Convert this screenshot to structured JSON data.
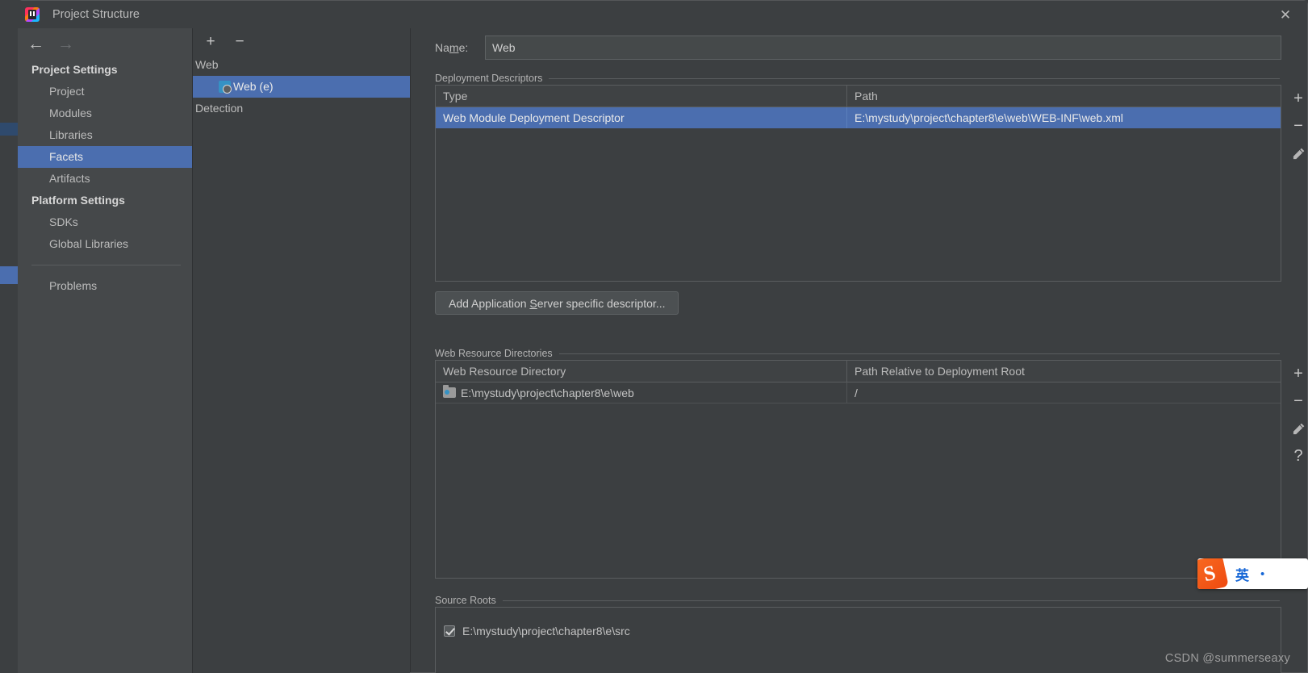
{
  "window": {
    "title": "Project Structure",
    "app_icon": "intellij-idea-icon",
    "close_label": "✕"
  },
  "nav": {
    "back_icon": "←",
    "forward_icon": "→",
    "sections": [
      {
        "group": "Project Settings",
        "items": [
          {
            "label": "Project",
            "selected": false
          },
          {
            "label": "Modules",
            "selected": false
          },
          {
            "label": "Libraries",
            "selected": false
          },
          {
            "label": "Facets",
            "selected": true
          },
          {
            "label": "Artifacts",
            "selected": false
          }
        ]
      },
      {
        "group": "Platform Settings",
        "items": [
          {
            "label": "SDKs",
            "selected": false
          },
          {
            "label": "Global Libraries",
            "selected": false
          }
        ]
      }
    ],
    "problems": "Problems"
  },
  "facets_panel": {
    "add_icon": "+",
    "remove_icon": "−",
    "tree": [
      {
        "label": "Web",
        "child": false,
        "selected": false,
        "icon": null
      },
      {
        "label": "Web (e)",
        "child": true,
        "selected": true,
        "icon": "web-facet-icon"
      },
      {
        "label": "Detection",
        "child": false,
        "selected": false,
        "icon": null
      }
    ]
  },
  "main": {
    "name_label_pre": "Na",
    "name_label_mnemonic": "m",
    "name_label_post": "e:",
    "name_value": "Web",
    "name_placeholder": "",
    "deployment": {
      "section_title": "Deployment Descriptors",
      "columns": [
        "Type",
        "Path"
      ],
      "rows": [
        {
          "type": "Web Module Deployment Descriptor",
          "path": "E:\\mystudy\\project\\chapter8\\e\\web\\WEB-INF\\web.xml",
          "selected": true
        }
      ],
      "tools": [
        "+",
        "−",
        "pencil-icon"
      ]
    },
    "add_descriptor_button": {
      "pre": "Add Application ",
      "mnemonic": "S",
      "post": "erver specific descriptor..."
    },
    "web_resources": {
      "section_title": "Web Resource Directories",
      "columns": [
        "Web Resource Directory",
        "Path Relative to Deployment Root"
      ],
      "rows": [
        {
          "directory": "E:\\mystudy\\project\\chapter8\\e\\web",
          "relative": "/",
          "icon": "folder-icon"
        }
      ],
      "tools": [
        "+",
        "−",
        "pencil-icon",
        "?"
      ]
    },
    "source_roots": {
      "section_title": "Source Roots",
      "rows": [
        {
          "path": "E:\\mystudy\\project\\chapter8\\e\\src",
          "checked": true
        }
      ]
    }
  },
  "overlays": {
    "ime": {
      "logo": "S",
      "mode": "英",
      "dot": "•"
    },
    "watermark": "CSDN @summerseaxy"
  },
  "colors": {
    "selection_blue": "#4b6eaf",
    "dialog_bg": "#3c3f41",
    "nav_bg": "#45484a",
    "text": "#bcbcbc",
    "border": "#5a5d5f",
    "facet_accent": "#3592c4"
  }
}
